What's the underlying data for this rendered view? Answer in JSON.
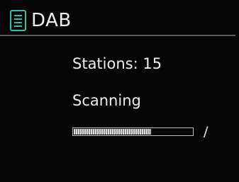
{
  "header": {
    "mode_title": "DAB",
    "mode_icon": "dab-radio-icon",
    "accent_color": "#34bfae"
  },
  "scan": {
    "stations_label": "Stations: 15",
    "status": "Scanning",
    "progress_fraction": 0.65,
    "spinner": "/"
  }
}
